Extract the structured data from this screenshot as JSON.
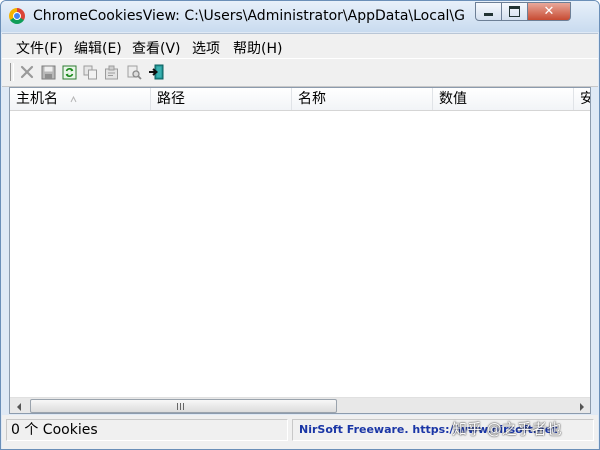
{
  "window": {
    "title": "ChromeCookiesView:   C:\\Users\\Administrator\\AppData\\Local\\G...",
    "controls": {
      "close_label": "✕"
    }
  },
  "menu": [
    {
      "label": "文件(F)"
    },
    {
      "label": "编辑(E)"
    },
    {
      "label": "查看(V)"
    },
    {
      "label": "选项"
    },
    {
      "label": "帮助(H)"
    }
  ],
  "toolbar": {
    "icons": [
      "delete-icon",
      "save-icon",
      "refresh-icon",
      "copy-icon",
      "properties-icon",
      "find-icon",
      "exit-icon"
    ]
  },
  "table": {
    "columns": [
      {
        "label": "主机名"
      },
      {
        "label": "路径"
      },
      {
        "label": "名称"
      },
      {
        "label": "数值"
      },
      {
        "label": "安"
      }
    ],
    "rows": [],
    "sort_column": "主机名"
  },
  "status": {
    "count_text": "0 个 Cookies",
    "link_text": "NirSoft Freeware.  https://www.nirsoft.net"
  },
  "watermark": "知乎 @之乎者也",
  "colors": {
    "link": "#1a36a6",
    "close_button": "#c74b32",
    "exit_icon": "#0e8a8a"
  }
}
